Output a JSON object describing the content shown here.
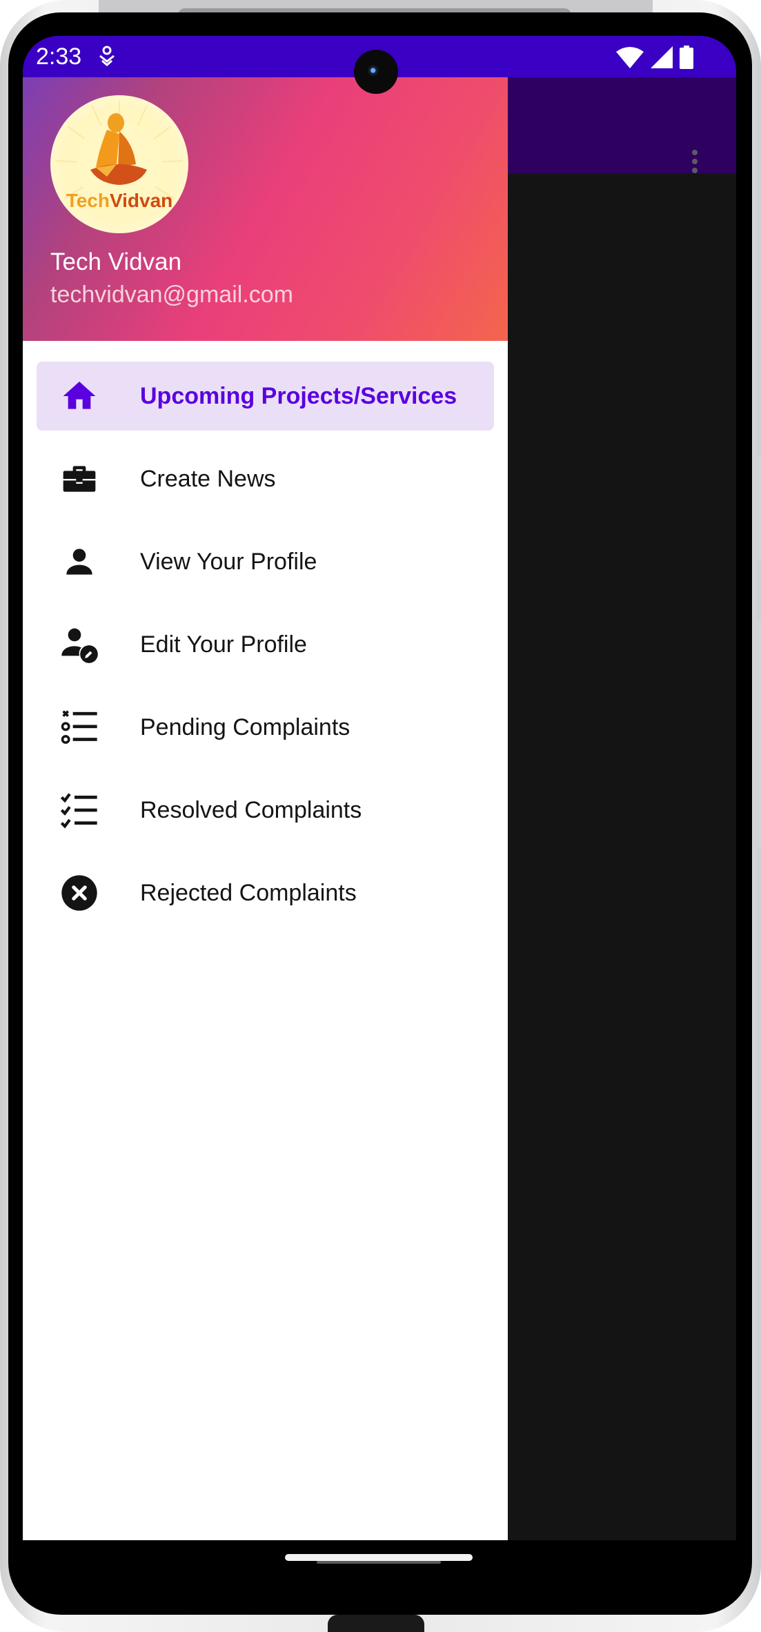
{
  "status_bar": {
    "time": "2:33",
    "icons": [
      "notification-icon",
      "wifi-icon",
      "cell-signal-icon",
      "battery-icon"
    ]
  },
  "app": {
    "toolbar_color": "#2e005f",
    "overflow_icon": "more-vert-icon"
  },
  "drawer": {
    "header": {
      "logo_text": "TechVidvan",
      "name": "Tech Vidvan",
      "email": "techvidvan@gmail.com"
    },
    "items": [
      {
        "label": "Upcoming Projects/Services",
        "icon": "home-icon",
        "active": true
      },
      {
        "label": "Create News",
        "icon": "briefcase-icon",
        "active": false
      },
      {
        "label": "View Your Profile",
        "icon": "person-icon",
        "active": false
      },
      {
        "label": "Edit Your Profile",
        "icon": "person-edit-icon",
        "active": false
      },
      {
        "label": "Pending Complaints",
        "icon": "pending-list-icon",
        "active": false
      },
      {
        "label": "Resolved Complaints",
        "icon": "checklist-icon",
        "active": false
      },
      {
        "label": "Rejected Complaints",
        "icon": "cancel-icon",
        "active": false
      }
    ]
  },
  "colors": {
    "status_bar": "#3a00c4",
    "accent": "#5a00df",
    "active_item_bg": "#ebdff8"
  }
}
